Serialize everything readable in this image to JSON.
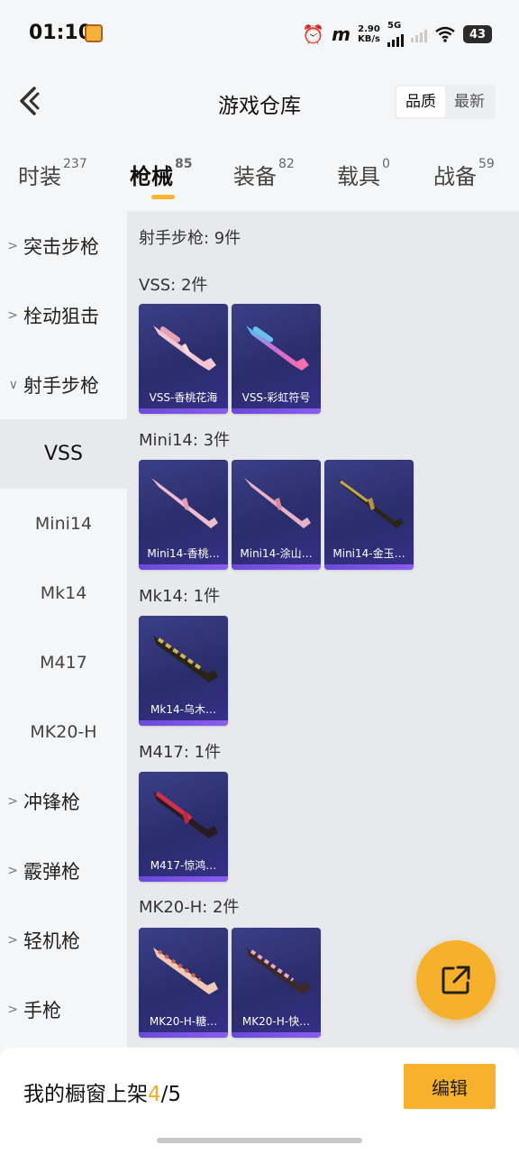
{
  "status_bar": {
    "time": "01:10",
    "speed_value": "2.90",
    "speed_unit": "KB/s",
    "network": "5G",
    "battery": "43"
  },
  "header": {
    "title": "游戏仓库",
    "sort_options": [
      "品质",
      "最新"
    ],
    "sort_active": "品质"
  },
  "tabs": [
    {
      "label": "时装",
      "count": "237"
    },
    {
      "label": "枪械",
      "count": "85"
    },
    {
      "label": "装备",
      "count": "82"
    },
    {
      "label": "载具",
      "count": "0"
    },
    {
      "label": "战备",
      "count": "59"
    }
  ],
  "sidebar": {
    "items": [
      {
        "label": "突击步枪",
        "expanded": false
      },
      {
        "label": "栓动狙击",
        "expanded": false
      },
      {
        "label": "射手步枪",
        "expanded": true
      },
      {
        "label": "VSS"
      },
      {
        "label": "Mini14"
      },
      {
        "label": "Mk14"
      },
      {
        "label": "M417"
      },
      {
        "label": "MK20-H"
      },
      {
        "label": "冲锋枪",
        "expanded": false
      },
      {
        "label": "霰弹枪",
        "expanded": false
      },
      {
        "label": "轻机枪",
        "expanded": false
      },
      {
        "label": "手枪",
        "expanded": false
      }
    ],
    "selected": "VSS"
  },
  "content": {
    "category_title": "射手步枪: 9件",
    "groups": [
      {
        "title": "VSS: 2件",
        "items": [
          "VSS-香桃花海",
          "VSS-彩虹符号"
        ]
      },
      {
        "title": "Mini14: 3件",
        "items": [
          "Mini14-香桃…",
          "Mini14-涂山…",
          "Mini14-金玉…"
        ]
      },
      {
        "title": "Mk14: 1件",
        "items": [
          "Mk14-乌木…"
        ]
      },
      {
        "title": "M417: 1件",
        "items": [
          "M417-惊鸿…"
        ]
      },
      {
        "title": "MK20-H: 2件",
        "items": [
          "MK20-H-糖…",
          "MK20-H-快…"
        ]
      }
    ]
  },
  "bottom_bar": {
    "label": "我的橱窗上架",
    "current": "4",
    "total": "/5",
    "edit_button": "编辑"
  },
  "colors": {
    "accent": "#f7b12d",
    "card_bg": "#2f3276",
    "card_bar": "#7c52e6"
  },
  "icons": {
    "back": "chevron-left-icon",
    "share": "external-link-icon",
    "expand": "chevron-right-icon",
    "collapse": "chevron-down-icon"
  }
}
